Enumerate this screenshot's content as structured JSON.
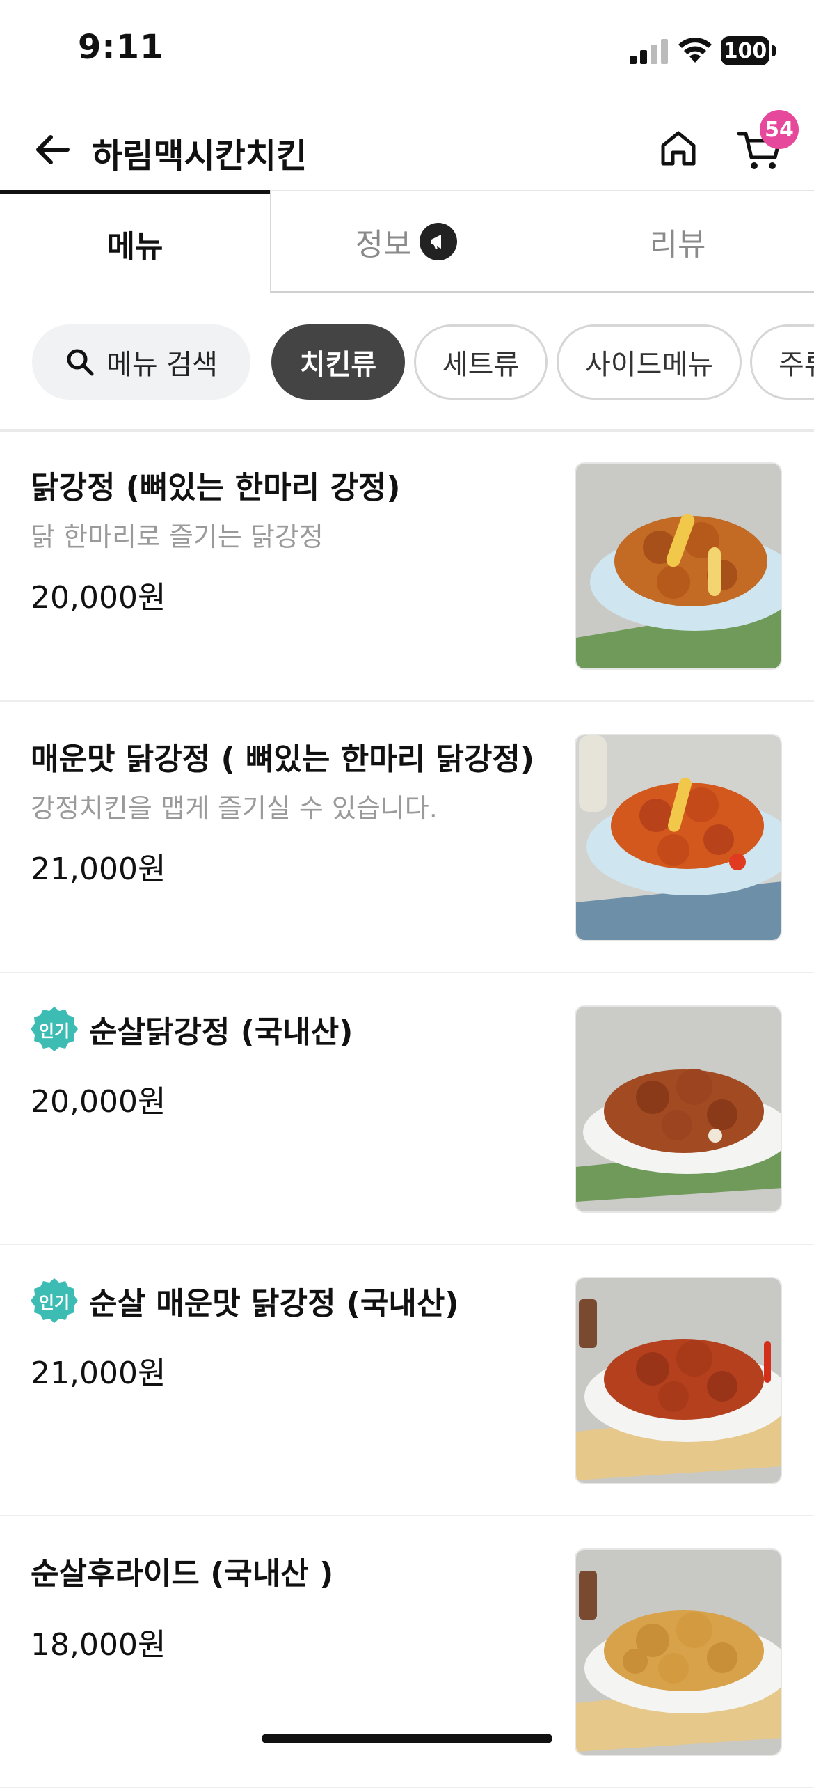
{
  "status_bar": {
    "time": "9:11",
    "battery": "100"
  },
  "header": {
    "title": "하림맥시칸치킨",
    "cart_count": "54"
  },
  "tabs": [
    {
      "label": "메뉴",
      "active": true
    },
    {
      "label": "정보",
      "icon": "megaphone-icon"
    },
    {
      "label": "리뷰"
    }
  ],
  "search": {
    "label": "메뉴 검색"
  },
  "categories": [
    {
      "label": "치킨류",
      "active": true
    },
    {
      "label": "세트류"
    },
    {
      "label": "사이드메뉴"
    },
    {
      "label": "주류"
    }
  ],
  "menu": [
    {
      "name": "닭강정 (뼈있는 한마리 강정)",
      "desc": "닭 한마리로 즐기는 닭강정",
      "price": "20,000원",
      "popular": false
    },
    {
      "name": "매운맛 닭강정 ( 뼈있는 한마리 닭강정)",
      "desc": "강정치킨을 맵게 즐기실 수 있습니다.",
      "price": "21,000원",
      "popular": false
    },
    {
      "name": "순살닭강정 (국내산)",
      "price": "20,000원",
      "popular": true,
      "badge": "인기"
    },
    {
      "name": "순살 매운맛 닭강정  (국내산)",
      "price": "21,000원",
      "popular": true,
      "badge": "인기"
    },
    {
      "name": "순살후라이드 (국내산 )",
      "price": "18,000원",
      "popular": false
    }
  ],
  "colors": {
    "accent_badge": "#e6489b",
    "popular_badge": "#3dbcb4",
    "active_chip": "#444444"
  }
}
